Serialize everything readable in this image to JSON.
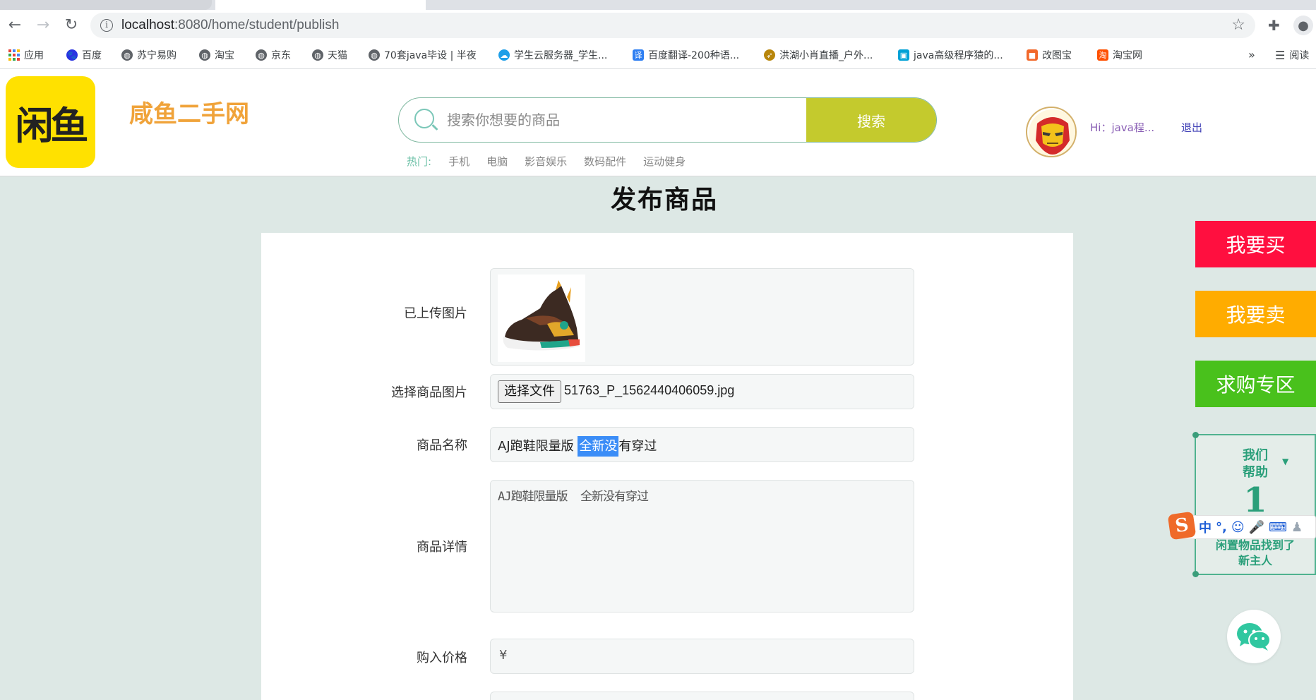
{
  "browser": {
    "url_host": "localhost",
    "url_rest": ":8080/home/student/publish",
    "bookmarks": [
      {
        "label": "应用",
        "icon": "apps-grid-icon"
      },
      {
        "label": "百度",
        "icon": "baidu-icon",
        "color": "#2932e1"
      },
      {
        "label": "苏宁易购",
        "icon": "globe-icon"
      },
      {
        "label": "淘宝",
        "icon": "globe-icon"
      },
      {
        "label": "京东",
        "icon": "globe-icon"
      },
      {
        "label": "天猫",
        "icon": "globe-icon"
      },
      {
        "label": "70套java毕设 | 半夜",
        "icon": "globe-icon"
      },
      {
        "label": "学生云服务器_学生...",
        "icon": "cloud-icon",
        "color": "#1e9fe8"
      },
      {
        "label": "百度翻译-200种语...",
        "icon": "translate-icon",
        "color": "#2f7ff2"
      },
      {
        "label": "洪湖小肖直播_户外...",
        "icon": "rocket-icon"
      },
      {
        "label": "java高级程序猿的...",
        "icon": "bilibili-icon",
        "color": "#00a1d6"
      },
      {
        "label": "改图宝",
        "icon": "gaitubao-icon",
        "color": "#f2682a"
      },
      {
        "label": "淘宝网",
        "icon": "taobao-icon",
        "color": "#ff5000"
      }
    ],
    "more_bookmarks": "»",
    "reading_list": "阅读"
  },
  "header": {
    "logo_text": "闲鱼",
    "site_name": "咸鱼二手网",
    "search_placeholder": "搜索你想要的商品",
    "search_button": "搜索",
    "hot_label": "热门:",
    "hot_items": [
      "手机",
      "电脑",
      "影音娱乐",
      "数码配件",
      "运动健身"
    ],
    "greeting": "Hi：java程...",
    "logout": "退出"
  },
  "page": {
    "title": "发布商品",
    "form": {
      "uploaded_label": "已上传图片",
      "choose_label": "选择商品图片",
      "choose_button": "选择文件",
      "file_name": "51763_P_1562440406059.jpg",
      "name_label": "商品名称",
      "name_before": "AJ跑鞋限量版 ",
      "name_selected": "全新没",
      "name_after": "有穿过",
      "detail_label": "商品详情",
      "detail_value": "AJ跑鞋限量版  全新没有穿过",
      "price_label": "购入价格",
      "price_value": "¥"
    }
  },
  "sidebar": {
    "buy": "我要买",
    "sell": "我要卖",
    "wanted": "求购专区",
    "buy_color": "#ff0f3f",
    "sell_color": "#ffac00",
    "wanted_color": "#49c11c",
    "help_line1": "我们",
    "help_line2": "帮助",
    "help_number": "1",
    "help_line3": "闲置物品找到了",
    "help_line4": "新主人"
  },
  "ime": {
    "logo": "S",
    "mode": "中"
  }
}
